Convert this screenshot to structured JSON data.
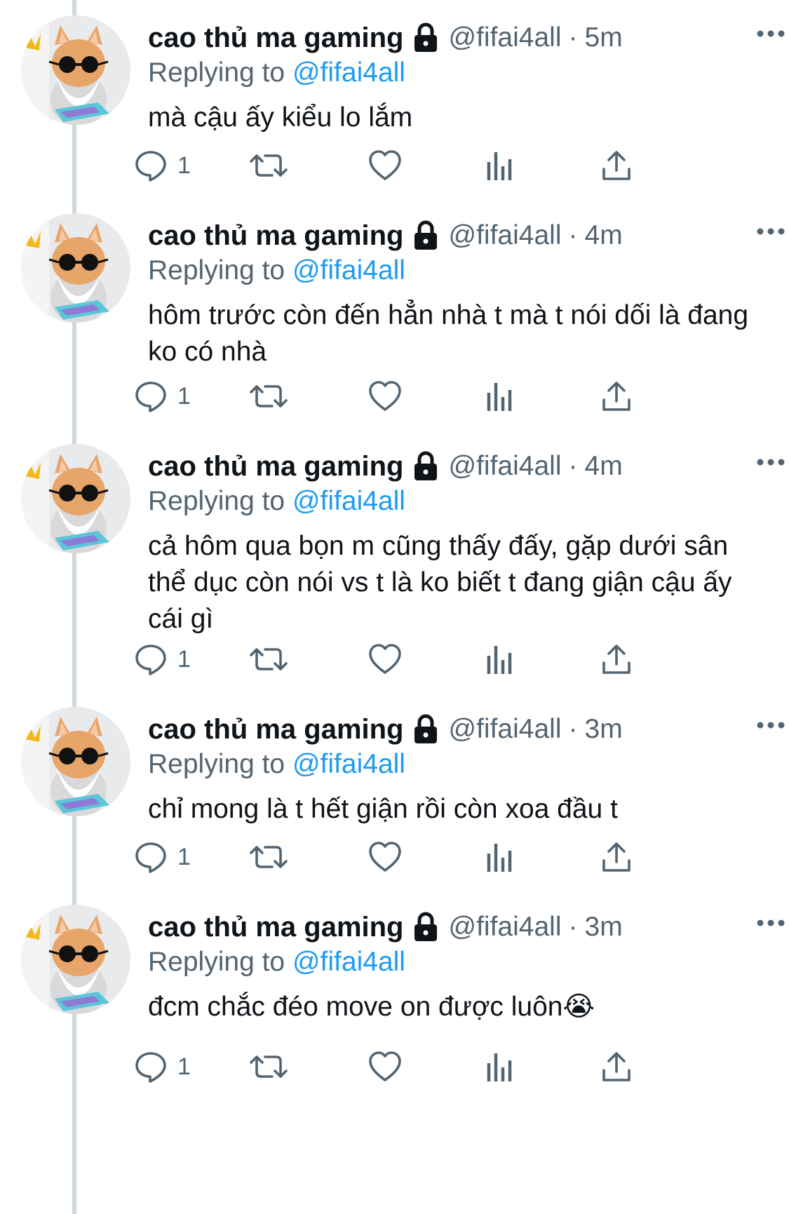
{
  "tweets": [
    {
      "name": "cao thủ ma gaming",
      "handle": "@fifai4all",
      "separator": "·",
      "time": "5m",
      "replying_prefix": "Replying to",
      "replying_to": "@fifai4all",
      "text": "mà cậu ấy kiểu lo lắm",
      "reply_count": "1"
    },
    {
      "name": "cao thủ ma gaming",
      "handle": "@fifai4all",
      "separator": "·",
      "time": "4m",
      "replying_prefix": "Replying to",
      "replying_to": "@fifai4all",
      "text": "hôm trước còn đến hẳn nhà t mà t nói dối là đang ko có nhà",
      "reply_count": "1"
    },
    {
      "name": "cao thủ ma gaming",
      "handle": "@fifai4all",
      "separator": "·",
      "time": "4m",
      "replying_prefix": "Replying to",
      "replying_to": "@fifai4all",
      "text": "cả hôm qua bọn m cũng thấy đấy, gặp dưới sân thể dục còn nói vs t là ko biết t đang giận cậu ấy cái gì",
      "reply_count": "1"
    },
    {
      "name": "cao thủ ma gaming",
      "handle": "@fifai4all",
      "separator": "·",
      "time": "3m",
      "replying_prefix": "Replying to",
      "replying_to": "@fifai4all",
      "text": "chỉ mong là t hết giận rồi còn xoa đầu t",
      "reply_count": "1"
    },
    {
      "name": "cao thủ ma gaming",
      "handle": "@fifai4all",
      "separator": "·",
      "time": "3m",
      "replying_prefix": "Replying to",
      "replying_to": "@fifai4all",
      "text": "đcm chắc đéo move on được luôn😭",
      "reply_count": "1"
    }
  ],
  "icons": {
    "lock": "lock-icon",
    "more": "more-icon",
    "reply": "reply-icon",
    "retweet": "retweet-icon",
    "like": "heart-icon",
    "views": "views-icon",
    "share": "share-icon"
  },
  "colors": {
    "text": "#0f1419",
    "secondary": "#536471",
    "link": "#1d9bf0",
    "thread_line": "#cfd9de"
  }
}
